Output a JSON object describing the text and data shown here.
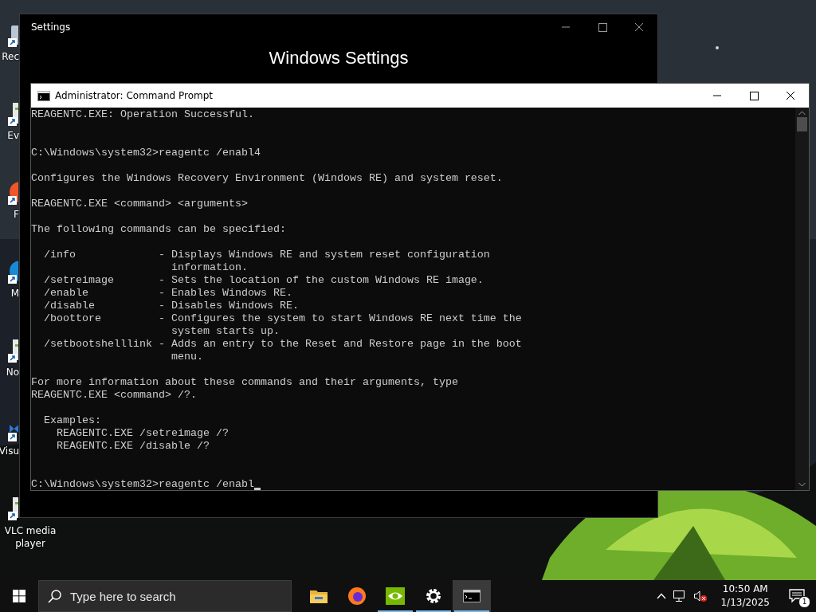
{
  "desktop_icons": [
    {
      "label": "Rec",
      "kind": "clipped"
    },
    {
      "label": "Ev",
      "kind": "clipped"
    },
    {
      "label": "F",
      "kind": "clipped"
    },
    {
      "label": "M",
      "kind": "clipped"
    },
    {
      "label": "No",
      "kind": "clipped"
    },
    {
      "label": "Visu",
      "kind": "clipped"
    },
    {
      "label": "VLC media player",
      "kind": "full"
    }
  ],
  "settings_window": {
    "title": "Settings",
    "heading": "Windows Settings"
  },
  "console_window": {
    "title": "Administrator: Command Prompt",
    "blocks": [
      {
        "kind": "first",
        "lines": [
          "REAGENTC.EXE: Operation Successful."
        ]
      },
      {
        "kind": "wide",
        "lines": [
          "C:\\Windows\\system32>reagentc /enabl4"
        ]
      },
      {
        "kind": "spaced",
        "lines": [
          "Configures the Windows Recovery Environment (Windows RE) and system reset."
        ]
      },
      {
        "kind": "spaced",
        "lines": [
          "REAGENTC.EXE <command> <arguments>"
        ]
      },
      {
        "kind": "spaced",
        "lines": [
          "The following commands can be specified:"
        ]
      },
      {
        "kind": "spaced",
        "lines": [
          "  /info             - Displays Windows RE and system reset configuration",
          "                      information.",
          "  /setreimage       - Sets the location of the custom Windows RE image.",
          "  /enable           - Enables Windows RE.",
          "  /disable          - Disables Windows RE.",
          "  /boottore         - Configures the system to start Windows RE next time the",
          "                      system starts up.",
          "  /setbootshelllink - Adds an entry to the Reset and Restore page in the boot",
          "                      menu."
        ]
      },
      {
        "kind": "spaced",
        "lines": [
          "For more information about these commands and their arguments, type",
          "REAGENTC.EXE <command> /?."
        ]
      },
      {
        "kind": "spaced",
        "lines": [
          "  Examples:",
          "    REAGENTC.EXE /setreimage /?",
          "    REAGENTC.EXE /disable /?"
        ]
      },
      {
        "kind": "wide",
        "lines": [
          "C:\\Windows\\system32>reagentc /enabl"
        ]
      }
    ]
  },
  "taskbar": {
    "search": {
      "placeholder": "Type here to search"
    },
    "apps": [
      {
        "kind": "folder",
        "running": false,
        "selected": false
      },
      {
        "kind": "browser",
        "running": false,
        "selected": false
      },
      {
        "kind": "eye",
        "running": true,
        "selected": false
      },
      {
        "kind": "gear",
        "running": true,
        "selected": false
      },
      {
        "kind": "terminal",
        "running": true,
        "selected": true
      }
    ],
    "tray": {
      "volume_muted": true,
      "time": "10:50 AM",
      "date": "1/13/2025",
      "notification_count": "1"
    }
  }
}
